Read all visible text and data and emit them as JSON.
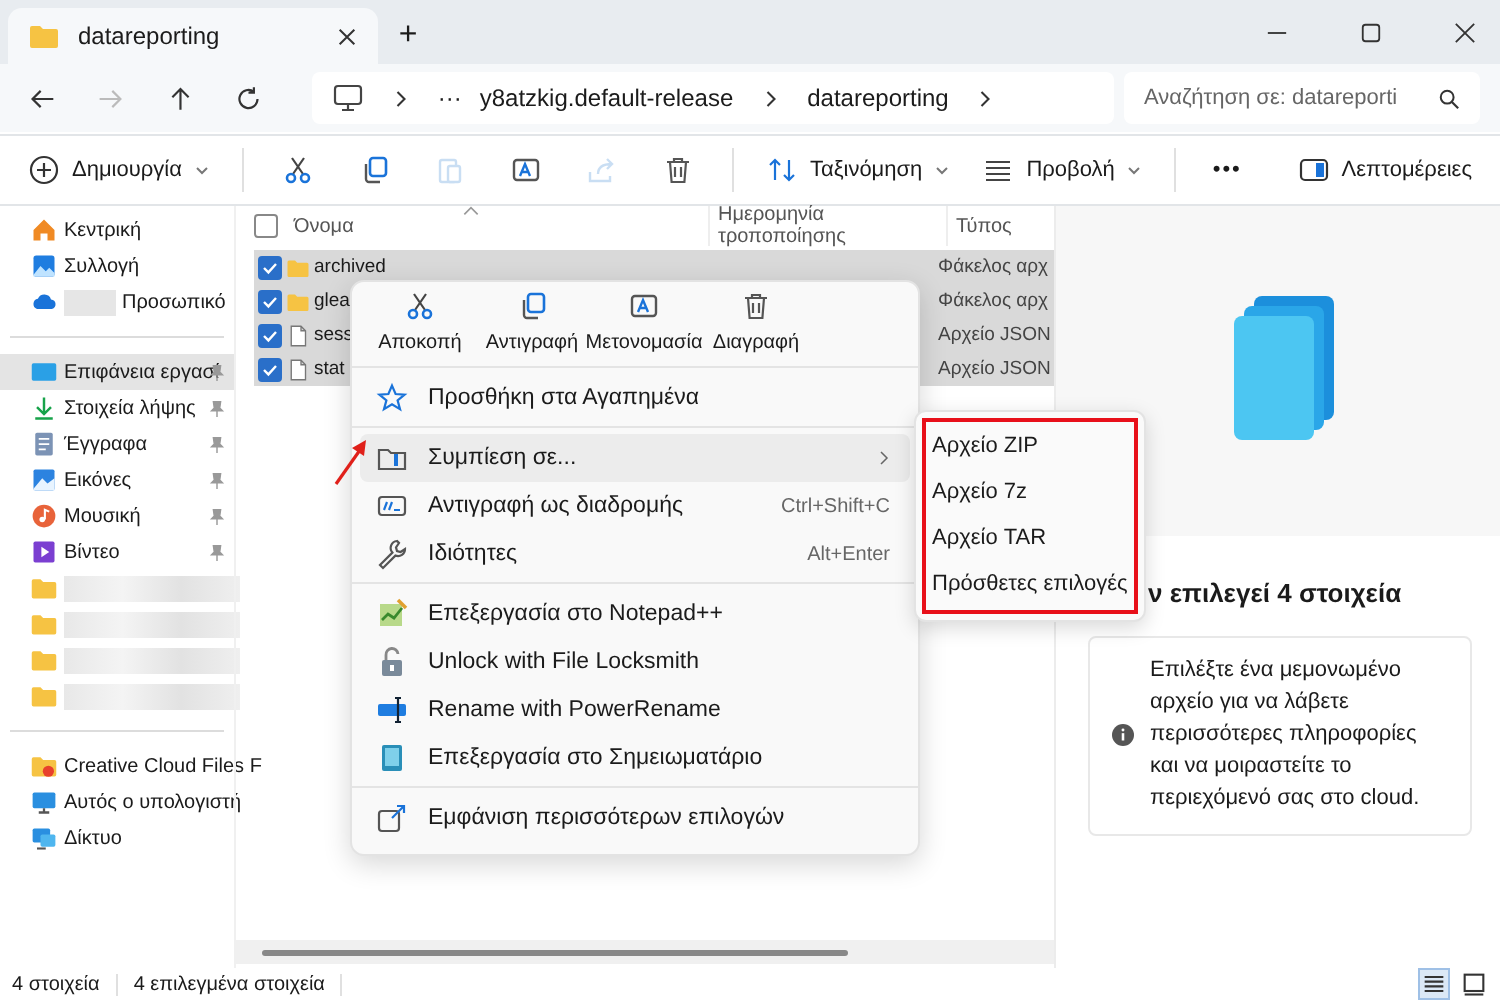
{
  "window": {
    "tab_title": "datareporting",
    "new_tab": "+"
  },
  "nav": {
    "back_disabled": false,
    "forward_disabled": true,
    "breadcrumb": [
      "y8atzkig.default-release",
      "datareporting"
    ],
    "overflow": "···",
    "search": {
      "placeholder": "Αναζήτηση σε: datareporti"
    }
  },
  "toolbar": {
    "new_label": "Δημιουργία",
    "icon_buttons": [
      {
        "kind": "cut",
        "disabled": false
      },
      {
        "kind": "copy",
        "disabled": false
      },
      {
        "kind": "paste",
        "disabled": true
      },
      {
        "kind": "rename",
        "disabled": false
      },
      {
        "kind": "share",
        "disabled": true
      },
      {
        "kind": "delete",
        "disabled": false
      }
    ],
    "sort_label": "Ταξινόμηση",
    "view_label": "Προβολή",
    "more": "•••",
    "details_label": "Λεπτομέρειες"
  },
  "sidebar": {
    "groups": [
      [
        {
          "kind": "home",
          "label": "Κεντρική",
          "selected": false,
          "pinned": false
        },
        {
          "kind": "gallery",
          "label": "Συλλογή",
          "selected": false,
          "pinned": false
        },
        {
          "kind": "cloud",
          "label": "Προσωπικό",
          "selected": false,
          "pinned": false,
          "redacted": true
        }
      ],
      [
        {
          "kind": "desktop",
          "label": "Επιφάνεια εργασί",
          "selected": true,
          "pinned": true
        },
        {
          "kind": "download",
          "label": "Στοιχεία λήψης",
          "selected": false,
          "pinned": true
        },
        {
          "kind": "documents",
          "label": "Έγγραφα",
          "selected": false,
          "pinned": true
        },
        {
          "kind": "pictures",
          "label": "Εικόνες",
          "selected": false,
          "pinned": true
        },
        {
          "kind": "music",
          "label": "Μουσική",
          "selected": false,
          "pinned": true
        },
        {
          "kind": "video",
          "label": "Βίντεο",
          "selected": false,
          "pinned": true
        },
        {
          "kind": "folder",
          "selected": false,
          "pinned": false,
          "redacted": true
        },
        {
          "kind": "folder",
          "selected": false,
          "pinned": false,
          "redacted": true
        },
        {
          "kind": "folder",
          "selected": false,
          "pinned": false,
          "redacted": true
        },
        {
          "kind": "folder",
          "selected": false,
          "pinned": false,
          "redacted": true
        }
      ],
      [
        {
          "kind": "cc",
          "label": "Creative Cloud Files F",
          "selected": false,
          "pinned": false
        },
        {
          "kind": "pc",
          "label": "Αυτός ο υπολογιστή",
          "selected": false,
          "pinned": false
        },
        {
          "kind": "network",
          "label": "Δίκτυο",
          "selected": false,
          "pinned": false
        }
      ]
    ]
  },
  "file_list": {
    "select_all_checked": false,
    "columns": [
      "Όνομα",
      "Ημερομηνία τροποποίησης",
      "Τύπος"
    ],
    "rows": [
      {
        "kind": "folder",
        "name": "archived",
        "type": "Φάκελος αρχ",
        "selected": true
      },
      {
        "kind": "folder",
        "name": "glea",
        "type": "Φάκελος αρχ",
        "selected": true
      },
      {
        "kind": "file",
        "name": "sess",
        "type": "Αρχείο JSON",
        "selected": true
      },
      {
        "kind": "file",
        "name": "stat",
        "type": "Αρχείο JSON",
        "selected": true
      }
    ]
  },
  "context_menu": {
    "quick_actions": [
      {
        "kind": "cut",
        "label": "Αποκοπή"
      },
      {
        "kind": "copy",
        "label": "Αντιγραφή"
      },
      {
        "kind": "rename",
        "label": "Μετονομασία"
      },
      {
        "kind": "delete",
        "label": "Διαγραφή"
      }
    ],
    "groups": [
      [
        {
          "kind": "star",
          "label": "Προσθήκη στα Αγαπημένα",
          "selected": false
        }
      ],
      [
        {
          "kind": "compress",
          "label": "Συμπίεση σε...",
          "selected": true,
          "submenu": true
        },
        {
          "kind": "path",
          "label": "Αντιγραφή ως διαδρομής",
          "shortcut": "Ctrl+Shift+C",
          "selected": false
        },
        {
          "kind": "wrench",
          "label": "Ιδιότητες",
          "shortcut": "Alt+Enter",
          "selected": false
        }
      ],
      [
        {
          "kind": "notepadpp",
          "label": "Επεξεργασία στο Notepad++",
          "selected": false
        },
        {
          "kind": "lock",
          "label": "Unlock with File Locksmith",
          "selected": false
        },
        {
          "kind": "powerrename",
          "label": "Rename with PowerRename",
          "selected": false
        },
        {
          "kind": "notepad",
          "label": "Επεξεργασία στο Σημειωματάριο",
          "selected": false
        }
      ],
      [
        {
          "kind": "more",
          "label": "Εμφάνιση περισσότερων επιλογών",
          "selected": false
        }
      ]
    ]
  },
  "submenu": {
    "items": [
      "Αρχείο ZIP",
      "Αρχείο 7z",
      "Αρχείο TAR",
      "Πρόσθετες επιλογές"
    ]
  },
  "details_pane": {
    "heading": "ν επιλεγεί 4 στοιχεία",
    "info": "Επιλέξτε ένα μεμονωμένο αρχείο για να λάβετε περισσότερες πληροφορίες και να μοιραστείτε το περιεχόμενό σας στο cloud."
  },
  "status_bar": {
    "count": "4 στοιχεία",
    "selected": "4 επιλεγμένα στοιχεία",
    "views": [
      {
        "kind": "details",
        "selected": true
      },
      {
        "kind": "tiles",
        "selected": false
      }
    ]
  }
}
